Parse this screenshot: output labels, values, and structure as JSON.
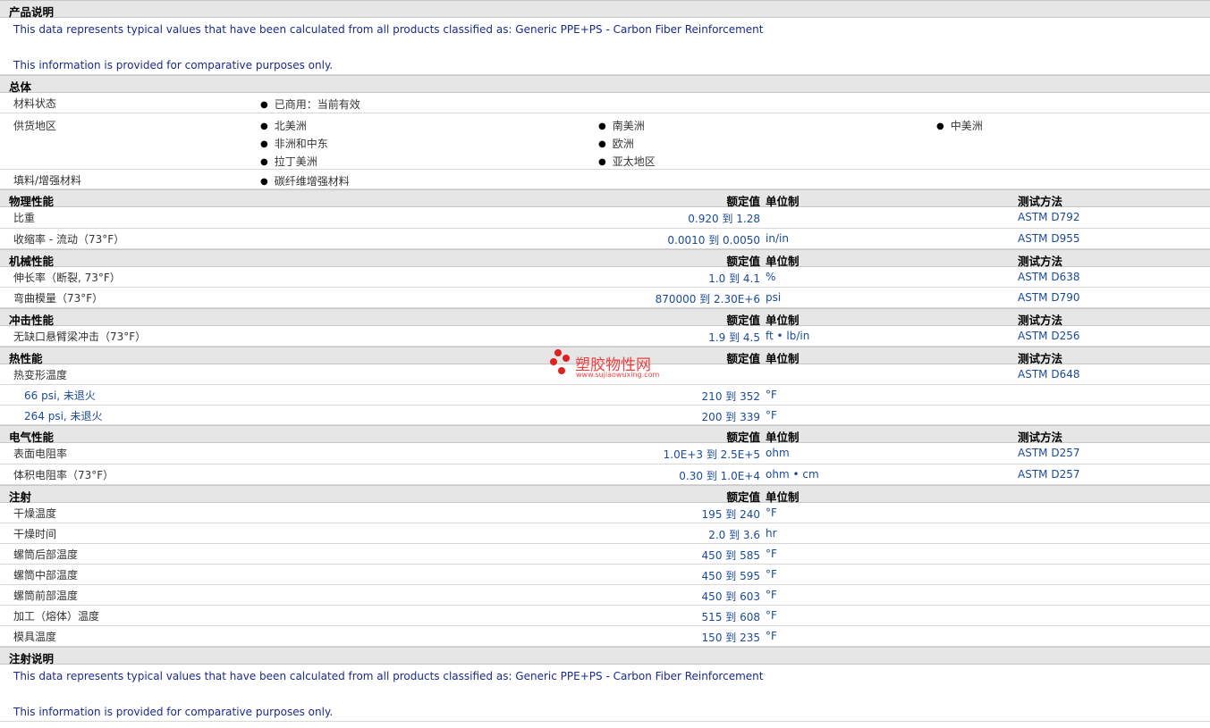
{
  "sections": {
    "desc": "产品说明",
    "general": "总体",
    "physical": "物理性能",
    "mechanical": "机械性能",
    "impact": "冲击性能",
    "thermal": "热性能",
    "electrical": "电气性能",
    "injection": "注射",
    "injection_notes": "注射说明"
  },
  "headers": {
    "nominal": "额定值",
    "unit": "单位制",
    "test": "测试方法"
  },
  "note1": "This data represents typical values that have been calculated from all products classified as: Generic PPE+PS - Carbon Fiber Reinforcement",
  "note2": "This information is provided for comparative purposes only.",
  "general": {
    "status_label": "材料状态",
    "status_value": "已商用：当前有效",
    "region_label": "供货地区",
    "regions": [
      "北美洲",
      "南美洲",
      "中美洲",
      "非洲和中东",
      "欧洲",
      "拉丁美洲",
      "亚太地区"
    ],
    "filler_label": "填料/增强材料",
    "filler_value": "碳纤维增强材料"
  },
  "rows": {
    "sg": {
      "label": "比重",
      "value": "0.920 到  1.28",
      "unit": "",
      "test": "ASTM D792"
    },
    "shrink": {
      "label": "收缩率 - 流动（73°F）",
      "value": "0.0010 到  0.0050",
      "unit": "in/in",
      "test": "ASTM D955"
    },
    "elong": {
      "label": "伸长率（断裂, 73°F）",
      "value": "1.0 到  4.1",
      "unit": "%",
      "test": "ASTM D638"
    },
    "flex": {
      "label": "弯曲模量（73°F）",
      "value": "870000 到  2.30E+6",
      "unit": "psi",
      "test": "ASTM D790"
    },
    "izod": {
      "label": "无缺口悬臂梁冲击（73°F）",
      "value": "1.9 到  4.5",
      "unit": "ft • lb/in",
      "test": "ASTM D256"
    },
    "hdt": {
      "label": "热变形温度",
      "test": "ASTM D648"
    },
    "hdt66": {
      "label": "66 psi, 未退火",
      "value": "210 到  352",
      "unit": "°F"
    },
    "hdt264": {
      "label": "264 psi, 未退火",
      "value": "200 到  339",
      "unit": "°F"
    },
    "surf": {
      "label": "表面电阻率",
      "value": "1.0E+3 到  2.5E+5",
      "unit": "ohm",
      "test": "ASTM D257"
    },
    "vol": {
      "label": "体积电阻率（73°F）",
      "value": "0.30 到  1.0E+4",
      "unit": "ohm • cm",
      "test": "ASTM D257"
    },
    "drytemp": {
      "label": "干燥温度",
      "value": "195 到  240",
      "unit": "°F"
    },
    "drytime": {
      "label": "干燥时间",
      "value": "2.0 到  3.6",
      "unit": "hr"
    },
    "rear": {
      "label": "螺筒后部温度",
      "value": "450 到  585",
      "unit": "°F"
    },
    "mid": {
      "label": "螺筒中部温度",
      "value": "450 到  595",
      "unit": "°F"
    },
    "front": {
      "label": "螺筒前部温度",
      "value": "450 到  603",
      "unit": "°F"
    },
    "melt": {
      "label": "加工（熔体）温度",
      "value": "515 到  608",
      "unit": "°F"
    },
    "mold": {
      "label": "模具温度",
      "value": "150 到  235",
      "unit": "°F"
    }
  },
  "watermark": {
    "cn": "塑胶物性网",
    "en": "www.sujiaowuxing.com"
  }
}
